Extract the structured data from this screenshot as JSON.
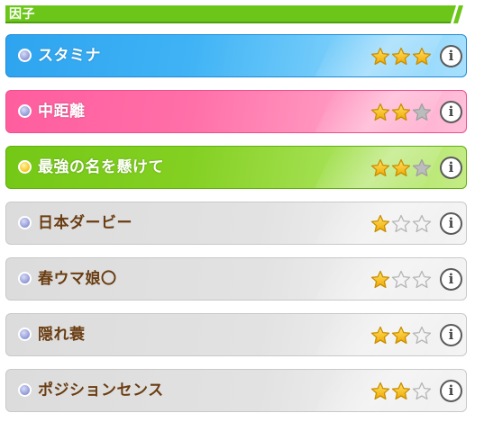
{
  "header": {
    "title": "因子"
  },
  "colors": {
    "header_green": "#6cc61a",
    "star_gold": "#f4c21c",
    "star_gray": "#b8b8b8",
    "label_brown": "#6a3d12"
  },
  "factors": [
    {
      "label": "スタミナ",
      "type": "blue",
      "stars": 3,
      "bullet": "blue"
    },
    {
      "label": "中距離",
      "type": "pink",
      "stars": 2,
      "bullet": "blue"
    },
    {
      "label": "最強の名を懸けて",
      "type": "green",
      "stars": 2,
      "bullet": "gold"
    },
    {
      "label": "日本ダービー",
      "type": "gray",
      "stars": 1,
      "bullet": "blue"
    },
    {
      "label": "春ウマ娘〇",
      "type": "gray",
      "stars": 1,
      "bullet": "blue"
    },
    {
      "label": "隠れ蓑",
      "type": "gray",
      "stars": 2,
      "bullet": "blue"
    },
    {
      "label": "ポジションセンス",
      "type": "gray",
      "stars": 2,
      "bullet": "blue"
    }
  ],
  "info_icon_glyph": "i"
}
